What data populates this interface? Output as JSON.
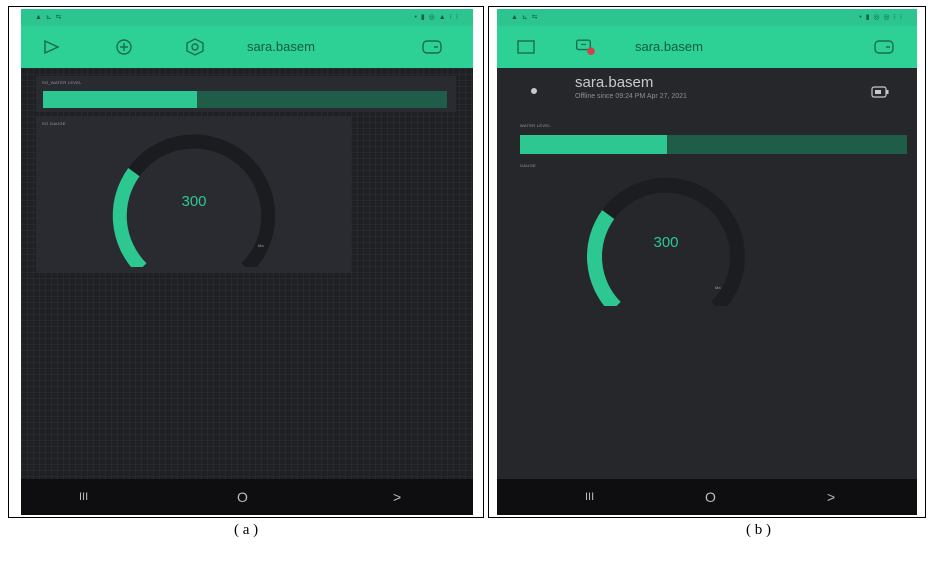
{
  "panel_a": {
    "status_left": "▲ ⊾ ⇆",
    "status_right": "• ▮ ◎ ▲ ⁝ ⁝",
    "title": "sara.basem",
    "bar_label": "SO_WATER LEVEL",
    "bar_fraction": 0.38,
    "gauge_label": "SO GAUGE",
    "gauge_value": "300",
    "gauge_min": "0",
    "gauge_max": "Ma",
    "gauge_fraction": 0.3
  },
  "panel_b": {
    "status_left": "▲ ⊾ ⇆",
    "status_right": "• ▮ ◎ ◎ ⁝ ⁝",
    "title": "sara.basem",
    "device_name": "sara.basem",
    "device_status": "Offline since 09:24 PM Apr 27, 2021",
    "bar_label": "WATER LEVEL",
    "bar_fraction": 0.38,
    "gauge_label": "GAUGE",
    "gauge_value": "300",
    "gauge_min": "0",
    "gauge_max": "Ma",
    "gauge_fraction": 0.3
  },
  "navbar": {
    "recents": "III",
    "home": "O",
    "back": ">"
  },
  "captions": {
    "a": "( a )",
    "b": "( b )"
  },
  "colors": {
    "accent": "#2dd196",
    "background": "#1f2024",
    "bar_track": "#1f5d49",
    "navbar": "#0e0e10"
  }
}
